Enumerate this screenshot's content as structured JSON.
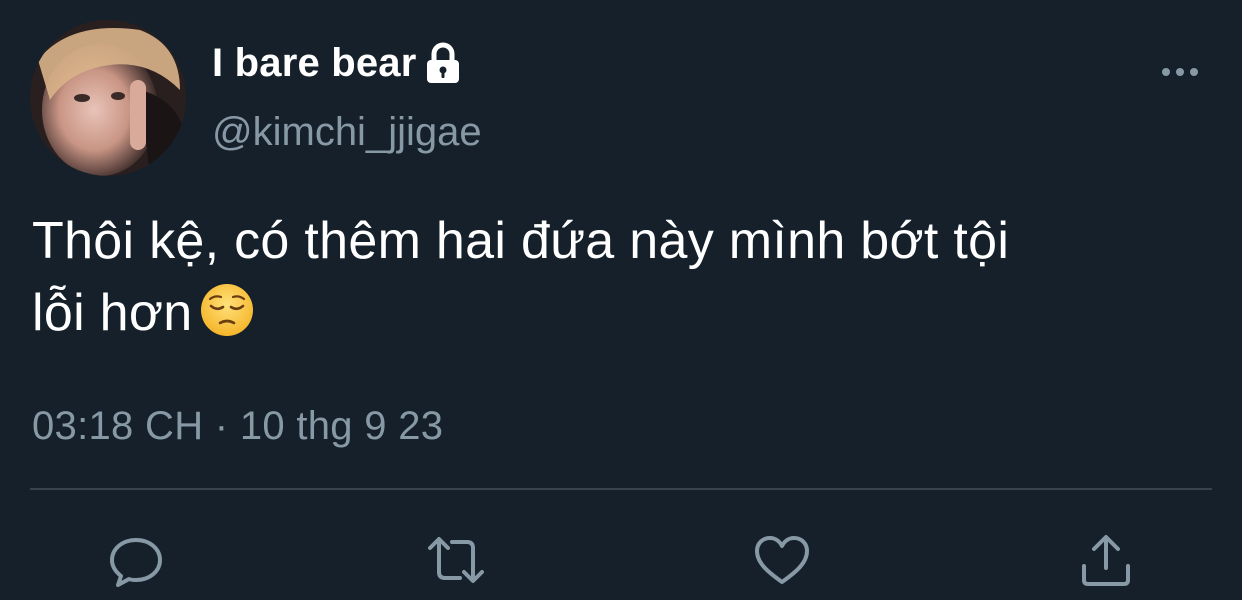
{
  "tweet": {
    "author": {
      "display_name": "I bare bear",
      "handle": "@kimchi_jjigae",
      "protected_icon": "lock-icon",
      "avatar_icon": "avatar"
    },
    "text_lines": [
      "Thôi kệ, có thêm hai đứa này mình bớt tội",
      "lỗi hơn"
    ],
    "emoji": "pensive-face-emoji",
    "time": "03:18 CH",
    "separator": " · ",
    "date": "10 thg 9 23",
    "actions": {
      "reply_icon": "reply-icon",
      "retweet_icon": "retweet-icon",
      "like_icon": "heart-icon",
      "share_icon": "share-icon"
    },
    "menu_icon": "more-icon"
  },
  "colors": {
    "background": "#15202b",
    "text_primary": "#ffffff",
    "text_secondary": "#8899a6",
    "divider": "#38444d",
    "icon": "#8899a6"
  }
}
